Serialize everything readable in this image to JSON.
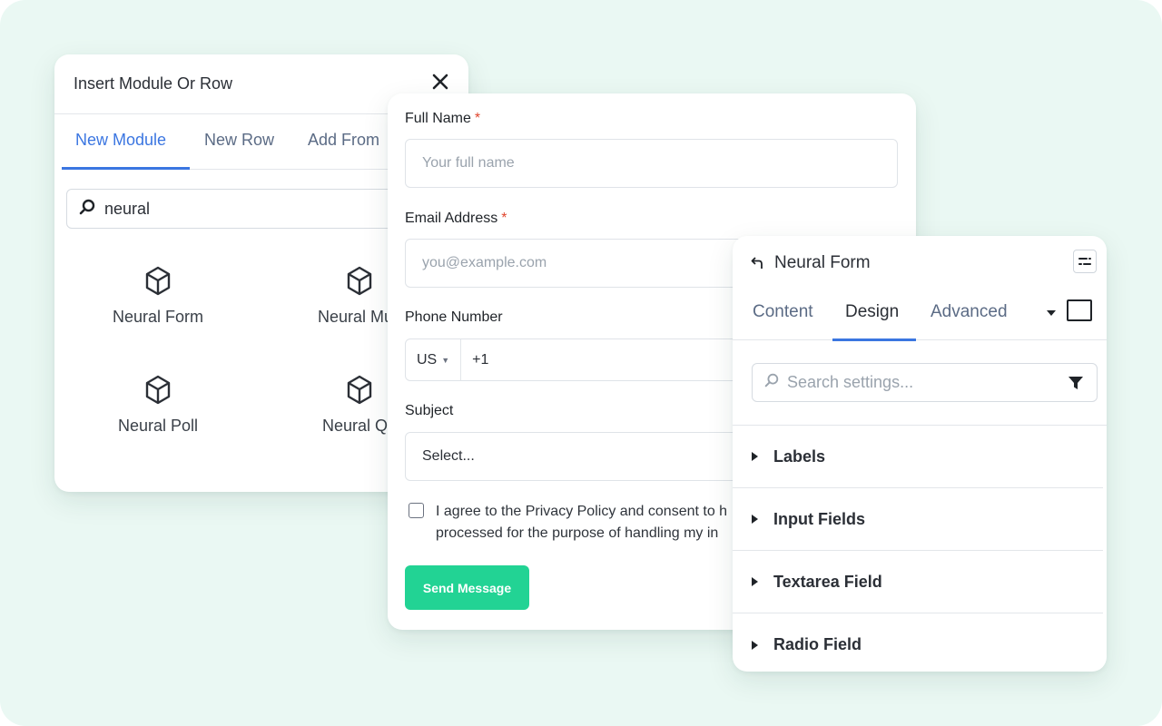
{
  "insert_panel": {
    "title": "Insert Module Or Row",
    "tabs": [
      "New Module",
      "New Row",
      "Add From"
    ],
    "search_value": "neural",
    "modules": [
      "Neural Form",
      "Neural Mult",
      "Neural Poll",
      "Neural Qu"
    ]
  },
  "form_panel": {
    "fields": {
      "full_name": {
        "label": "Full Name",
        "placeholder": "Your full name"
      },
      "email": {
        "label": "Email Address",
        "placeholder": "you@example.com"
      },
      "phone": {
        "label": "Phone Number",
        "country": "US",
        "code": "+1"
      },
      "subject": {
        "label": "Subject",
        "value": "Select..."
      }
    },
    "required_mark": "*",
    "consent_text": "I agree to the Privacy Policy and consent to h processed for the purpose of handling my in",
    "submit_label": "Send Message"
  },
  "settings_panel": {
    "title": "Neural Form",
    "tabs": [
      "Content",
      "Design",
      "Advanced"
    ],
    "active_tab": "Design",
    "search_placeholder": "Search settings...",
    "sections": [
      "Labels",
      "Input Fields",
      "Textarea Field",
      "Radio Field"
    ]
  },
  "colors": {
    "background": "#eaf8f3",
    "accent_blue": "#3b76e1",
    "send_button": "#22d394",
    "required": "#e0452d"
  },
  "icons": [
    "close-icon",
    "search-icon",
    "cube-icon",
    "undo-icon",
    "toggle-icon",
    "dropdown-caret-icon",
    "filter-icon",
    "chevron-right-icon"
  ]
}
